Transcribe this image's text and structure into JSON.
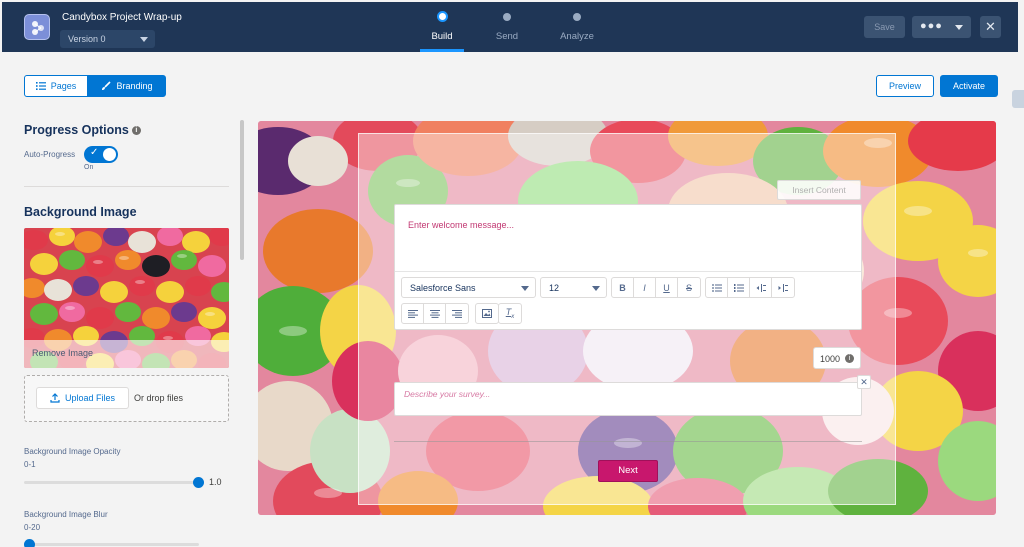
{
  "header": {
    "title": "Candybox Project Wrap-up",
    "version": "Version 0",
    "steps": [
      {
        "label": "Build",
        "active": true
      },
      {
        "label": "Send",
        "active": false
      },
      {
        "label": "Analyze",
        "active": false
      }
    ],
    "save_label": "Save",
    "more_label": "●●●",
    "close_label": "✕"
  },
  "subheader": {
    "tabs": [
      {
        "label": "Pages",
        "icon": "list-icon",
        "selected": false
      },
      {
        "label": "Branding",
        "icon": "brush-icon",
        "selected": true
      }
    ],
    "preview_label": "Preview",
    "activate_label": "Activate"
  },
  "sidebar": {
    "progress_title": "Progress Options",
    "auto_progress_label": "Auto-Progress",
    "auto_progress_state": "On",
    "background_title": "Background Image",
    "remove_image_label": "Remove Image",
    "upload_label": "Upload Files",
    "drop_label": "Or drop files",
    "opacity_label": "Background Image Opacity",
    "opacity_range": "0-1",
    "opacity_value": "1.0",
    "blur_label": "Background Image Blur",
    "blur_range": "0-20"
  },
  "canvas": {
    "insert_content_label": "Insert Content",
    "welcome_placeholder": "Enter welcome message...",
    "font_family": "Salesforce Sans",
    "font_size": "12",
    "char_count": "1000",
    "description_placeholder": "Describe your survey...",
    "next_label": "Next"
  },
  "colors": {
    "header_bg": "#1f3656",
    "brand_blue": "#0176d3",
    "next_button": "#c8176d"
  }
}
